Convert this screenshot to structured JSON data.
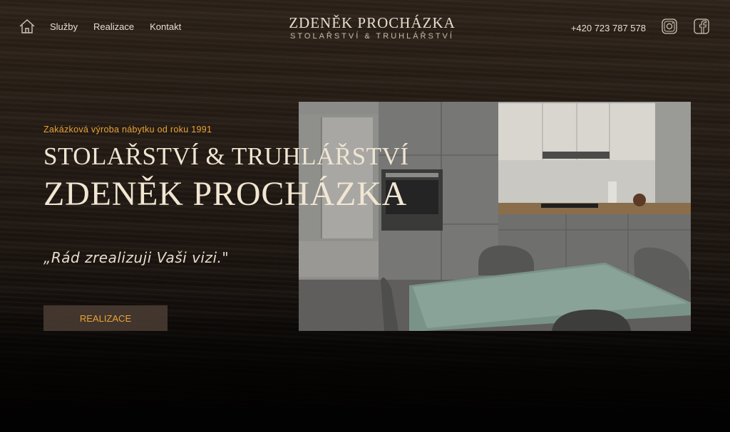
{
  "nav": {
    "home_icon": "home-icon",
    "links": [
      "Služby",
      "Realizace",
      "Kontakt"
    ]
  },
  "brand": {
    "name": "ZDENĚK PROCHÁZKA",
    "subtitle": "STOLAŘSTVÍ & TRUHLÁŘSTVÍ"
  },
  "contact": {
    "phone": "+420 723 787 578",
    "social_icons": [
      "instagram-icon",
      "facebook-icon"
    ]
  },
  "hero": {
    "tagline": "Zakázková výroba nábytku od roku 1991",
    "title_line1": "STOLAŘSTVÍ & TRUHLÁŘSTVÍ",
    "title_line2": "ZDENĚK PROCHÁZKA",
    "quote": "„Rád zrealizuji Vaši vizi.\"",
    "cta_label": "REALIZACE"
  },
  "colors": {
    "accent": "#e9a337",
    "text_light": "#efe5d2",
    "background_wood": "#241b14"
  }
}
